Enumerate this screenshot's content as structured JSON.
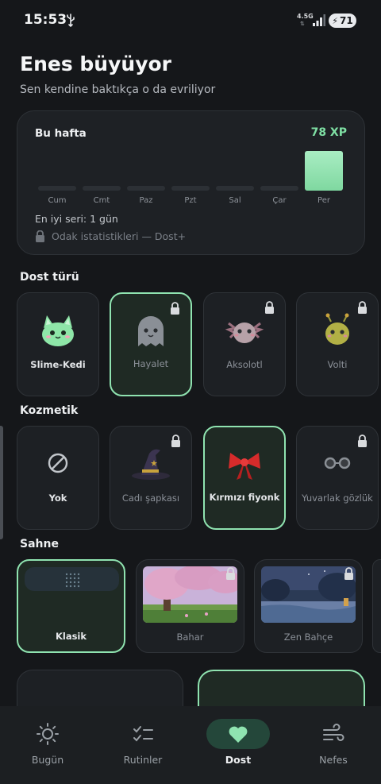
{
  "status_bar": {
    "time": "15:53",
    "network": "4.5G",
    "network_arrows": "⇅",
    "battery": "71"
  },
  "header": {
    "title": "Enes büyüyor",
    "subtitle": "Sen kendine baktıkça o da evriliyor"
  },
  "week": {
    "title": "Bu hafta",
    "xp": "78 XP",
    "days": [
      "Cum",
      "Cmt",
      "Paz",
      "Pzt",
      "Sal",
      "Çar",
      "Per"
    ],
    "xp_per_day": [
      0,
      0,
      0,
      0,
      0,
      0,
      78
    ],
    "best_streak": "En iyi seri: 1 gün",
    "locked_stats": "Odak istatistikleri — Dost+"
  },
  "sections": {
    "companion": "Dost türü",
    "cosmetics": "Kozmetik",
    "scene": "Sahne"
  },
  "companions": [
    {
      "label": "Slime-Kedi",
      "locked": false,
      "selected": false,
      "icon": "slime-cat-icon"
    },
    {
      "label": "Hayalet",
      "locked": true,
      "selected": true,
      "icon": "ghost-icon"
    },
    {
      "label": "Aksolotl",
      "locked": true,
      "selected": false,
      "icon": "axolotl-icon"
    },
    {
      "label": "Volti",
      "locked": true,
      "selected": false,
      "icon": "volti-icon"
    }
  ],
  "cosmetics": [
    {
      "label": "Yok",
      "locked": false,
      "selected": false,
      "icon": "none-icon"
    },
    {
      "label": "Cadı şapkası",
      "locked": true,
      "selected": false,
      "icon": "witch-hat-icon"
    },
    {
      "label": "Kırmızı fiyonk",
      "locked": true,
      "selected": true,
      "icon": "red-bow-icon"
    },
    {
      "label": "Yuvarlak gözlük",
      "locked": true,
      "selected": false,
      "icon": "round-glasses-icon"
    }
  ],
  "scenes": [
    {
      "label": "Klasik",
      "locked": false,
      "selected": true
    },
    {
      "label": "Bahar",
      "locked": true,
      "selected": false
    },
    {
      "label": "Zen Bahçe",
      "locked": true,
      "selected": false
    }
  ],
  "nav": [
    {
      "label": "Bugün",
      "icon": "sun-icon",
      "active": false
    },
    {
      "label": "Rutinler",
      "icon": "checklist-icon",
      "active": false
    },
    {
      "label": "Dost",
      "icon": "heart-icon",
      "active": true
    },
    {
      "label": "Nefes",
      "icon": "wind-icon",
      "active": false
    }
  ],
  "colors": {
    "accent": "#8fe3b0",
    "background": "#15171a",
    "card": "#1e2125"
  }
}
